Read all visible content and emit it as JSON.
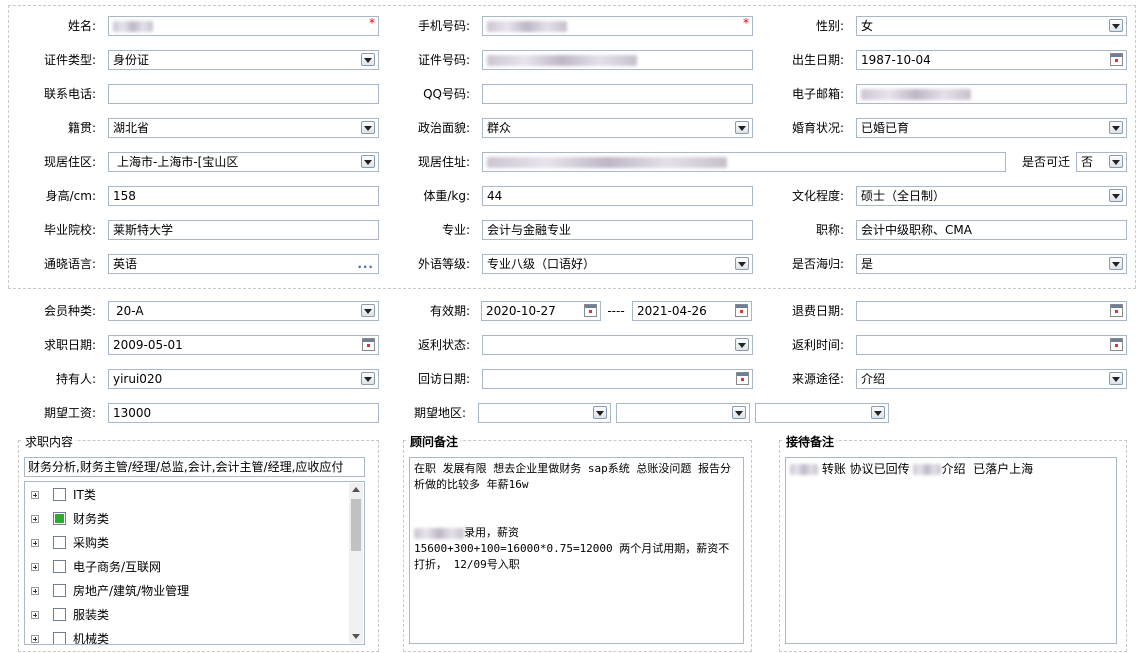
{
  "section1": {
    "name": {
      "label": "姓名:",
      "required_mark": "*"
    },
    "mobile": {
      "label": "手机号码:",
      "required_mark": "*"
    },
    "gender": {
      "label": "性别:",
      "value": "女"
    },
    "id_type": {
      "label": "证件类型:",
      "value": "身份证"
    },
    "id_number": {
      "label": "证件号码:"
    },
    "birth_date": {
      "label": "出生日期:",
      "value": "1987-10-04"
    },
    "phone": {
      "label": "联系电话:",
      "value": ""
    },
    "qq": {
      "label": "QQ号码:",
      "value": ""
    },
    "email": {
      "label": "电子邮箱:"
    },
    "native_place": {
      "label": "籍贯:",
      "value": "湖北省"
    },
    "political": {
      "label": "政治面貌:",
      "value": "群众"
    },
    "marital": {
      "label": "婚育状况:",
      "value": "已婚已育"
    },
    "residence_area": {
      "label": "现居住区:",
      "value": "上海市-上海市-[宝山区"
    },
    "residence_address": {
      "label": "现居住址:"
    },
    "relocate": {
      "label": "是否可迁",
      "value": "否"
    },
    "height": {
      "label": "身高/cm:",
      "value": "158"
    },
    "weight": {
      "label": "体重/kg:",
      "value": "44"
    },
    "education": {
      "label": "文化程度:",
      "value": "硕士（全日制）"
    },
    "school": {
      "label": "毕业院校:",
      "value": "莱斯特大学"
    },
    "major": {
      "label": "专业:",
      "value": "会计与金融专业"
    },
    "title": {
      "label": "职称:",
      "value": "会计中级职称、CMA"
    },
    "languages": {
      "label": "通晓语言:",
      "value": "英语",
      "more_icon": "..."
    },
    "foreign_level": {
      "label": "外语等级:",
      "value": "专业八级（口语好）"
    },
    "overseas": {
      "label": "是否海归:",
      "value": "是"
    }
  },
  "section2": {
    "member_type": {
      "label": "会员种类:",
      "value": "20-A"
    },
    "validity": {
      "label": "有效期:",
      "from": "2020-10-27",
      "separator": "----",
      "to": "2021-04-26"
    },
    "refund_date": {
      "label": "退费日期:",
      "value": ""
    },
    "apply_date": {
      "label": "求职日期:",
      "value": "2009-05-01"
    },
    "rebate_status": {
      "label": "返利状态:",
      "value": ""
    },
    "rebate_time": {
      "label": "返利时间:",
      "value": ""
    },
    "holder": {
      "label": "持有人:",
      "value": "yirui020"
    },
    "visit_date": {
      "label": "回访日期:",
      "value": ""
    },
    "source": {
      "label": "来源途径:",
      "value": "介绍"
    },
    "expected_salary": {
      "label": "期望工资:",
      "value": "13000"
    },
    "expected_area": {
      "label": "期望地区:"
    }
  },
  "job_content": {
    "legend": "求职内容",
    "summary": "财务分析,财务主管/经理/总监,会计,会计主管/经理,应收应付",
    "tree_items": [
      {
        "label": "IT类",
        "checked": false
      },
      {
        "label": "财务类",
        "checked": true
      },
      {
        "label": "采购类",
        "checked": false
      },
      {
        "label": "电子商务/互联网",
        "checked": false
      },
      {
        "label": "房地产/建筑/物业管理",
        "checked": false
      },
      {
        "label": "服装类",
        "checked": false
      },
      {
        "label": "机械类",
        "checked": false
      }
    ]
  },
  "consultant_notes": {
    "legend": "顾问备注",
    "line1": "在职 发展有限 想去企业里做财务 sap系统 总账没问题 报告分析做的比较多 年薪16w",
    "line2_suffix": "录用，薪资",
    "line3": "15600+300+100=16000*0.75=12000 两个月试用期，薪资不打折， 12/09号入职"
  },
  "reception_notes": {
    "legend": "接待备注",
    "part1": "转账 协议已回传",
    "part2": "介绍  已落户上海"
  },
  "icons": {
    "select": "chevron-down-icon",
    "calendar": "calendar-icon",
    "more": "more-dots-icon",
    "expand": "plus-expand-icon"
  }
}
